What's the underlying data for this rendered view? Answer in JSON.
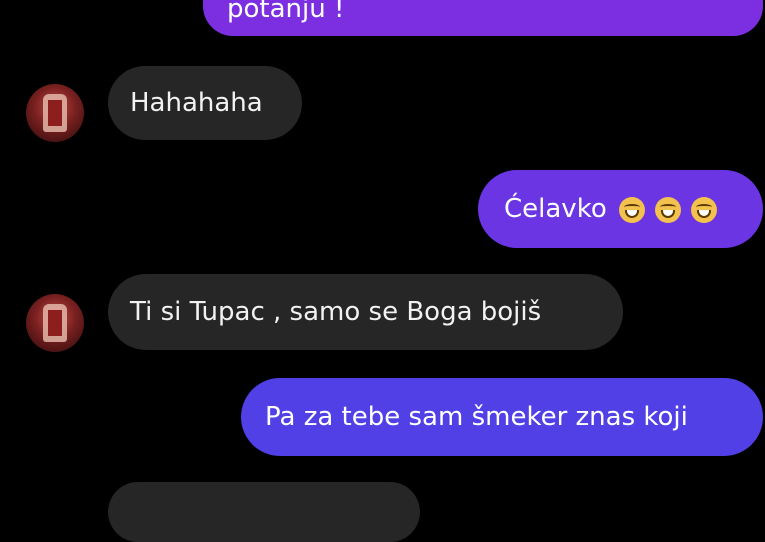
{
  "colors": {
    "incoming_bubble": "#262626",
    "outgoing_gradient_start": "#8a2be2",
    "outgoing_gradient_end": "#4f4ae6",
    "background": "#000000"
  },
  "messages": [
    {
      "direction": "outgoing",
      "text": "potanju !"
    },
    {
      "direction": "incoming",
      "text": "Hahahaha",
      "avatar": "contact-avatar"
    },
    {
      "direction": "outgoing",
      "text": "Ćelavko",
      "emojis": [
        "laughing-emoji",
        "laughing-emoji",
        "laughing-emoji"
      ]
    },
    {
      "direction": "incoming",
      "text": "Ti si Tupac , samo se Boga bojiš",
      "avatar": "contact-avatar"
    },
    {
      "direction": "outgoing",
      "text": "Pa za tebe sam šmeker znas koji"
    }
  ]
}
